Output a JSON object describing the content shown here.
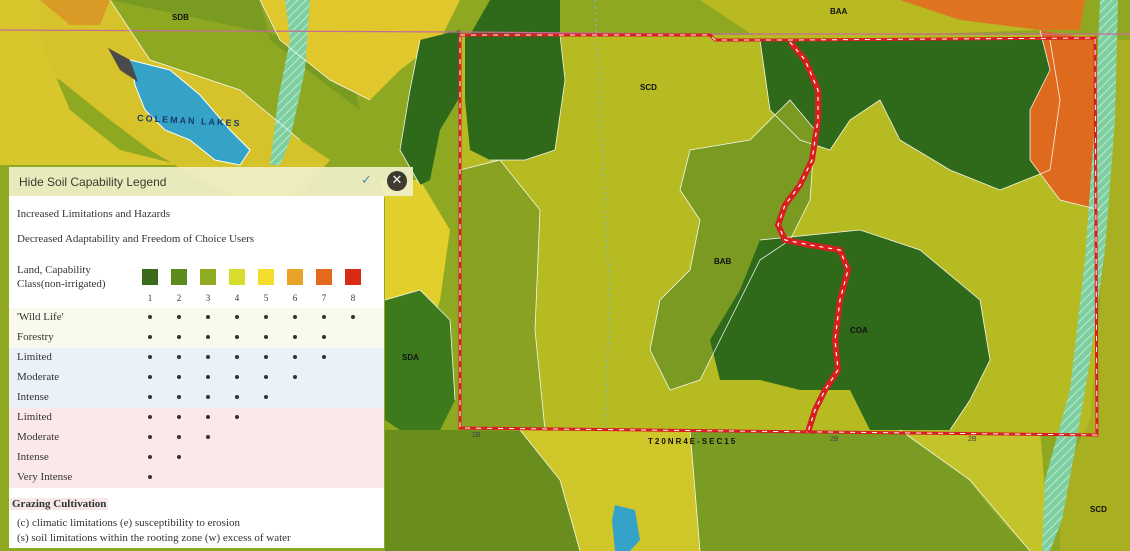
{
  "map": {
    "labels": {
      "sdb": "SDB",
      "baa": "BAA",
      "scd_top": "SCD",
      "bab": "BAB",
      "coa": "COA",
      "sda": "SDA",
      "scd_right": "SCD",
      "lake": "COLEMAN LAKES",
      "section": "T20NR4E-SEC15",
      "road_2b_1": "2B",
      "road_2b_2": "2B",
      "road_2b_3": "2B"
    }
  },
  "legend": {
    "header_label": "Hide Soil Capability Legend",
    "close_icon": "close-circle-icon",
    "line1": "Increased Limitations and Hazards",
    "line2": "Decreased Adaptability and Freedom of Choice Users",
    "class_label_1": "Land, Capability",
    "class_label_2": "Class(non-irrigated)",
    "class_colors": [
      "#3a6b1a",
      "#5c8a1e",
      "#8fac22",
      "#d6dd2a",
      "#f5dd2c",
      "#e9a22a",
      "#e36a1c",
      "#d82a14"
    ],
    "class_numbers": [
      "1",
      "2",
      "3",
      "4",
      "5",
      "6",
      "7",
      "8"
    ],
    "rows": [
      {
        "label": "'Wild Life'",
        "dots": 8,
        "bg": "#f9f9ec"
      },
      {
        "label": "Forestry",
        "dots": 7,
        "bg": "#f9f9ec"
      },
      {
        "label": "Limited",
        "dots": 7,
        "bg": "#eaf1f9"
      },
      {
        "label": "Moderate",
        "dots": 6,
        "bg": "#eaf1f9"
      },
      {
        "label": "Intense",
        "dots": 5,
        "bg": "#eaf1f9"
      },
      {
        "label": "Limited",
        "dots": 4,
        "bg": "#fbe9ea"
      },
      {
        "label": "Moderate",
        "dots": 3,
        "bg": "#fbe9ea"
      },
      {
        "label": "Intense",
        "dots": 2,
        "bg": "#fbe9ea"
      },
      {
        "label": "Very Intense",
        "dots": 1,
        "bg": "#fbe9ea"
      }
    ],
    "grazing_title": "Grazing Cultivation",
    "note1": "(c) climatic limitations (e) susceptibility to erosion",
    "note2": "(s) soil limitations within the rooting zone (w) excess of water"
  }
}
